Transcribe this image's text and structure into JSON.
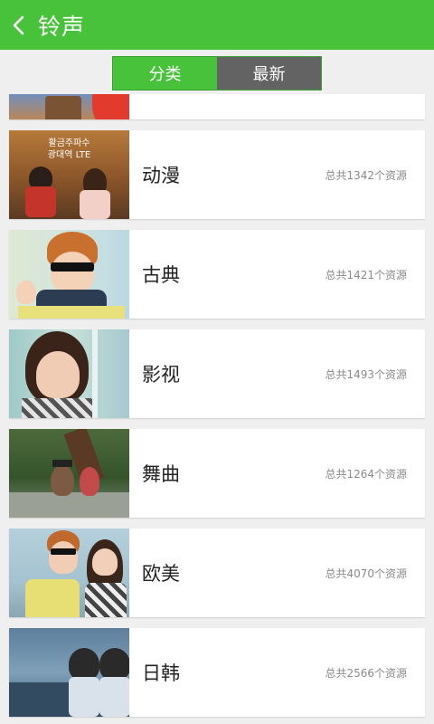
{
  "header": {
    "title": "铃声"
  },
  "tabs": {
    "category_label": "分类",
    "latest_label": "最新"
  },
  "categories": [
    {
      "name": "动漫",
      "count_text": "总共1342个资源",
      "thumb_caption_line1": "활금주파수",
      "thumb_caption_line2": "광대역 LTE"
    },
    {
      "name": "古典",
      "count_text": "总共1421个资源"
    },
    {
      "name": "影视",
      "count_text": "总共1493个资源"
    },
    {
      "name": "舞曲",
      "count_text": "总共1264个资源"
    },
    {
      "name": "欧美",
      "count_text": "总共4070个资源"
    },
    {
      "name": "日韩",
      "count_text": "总共2566个资源"
    }
  ],
  "colors": {
    "accent": "#47c23a",
    "tab_inactive": "#636363"
  }
}
